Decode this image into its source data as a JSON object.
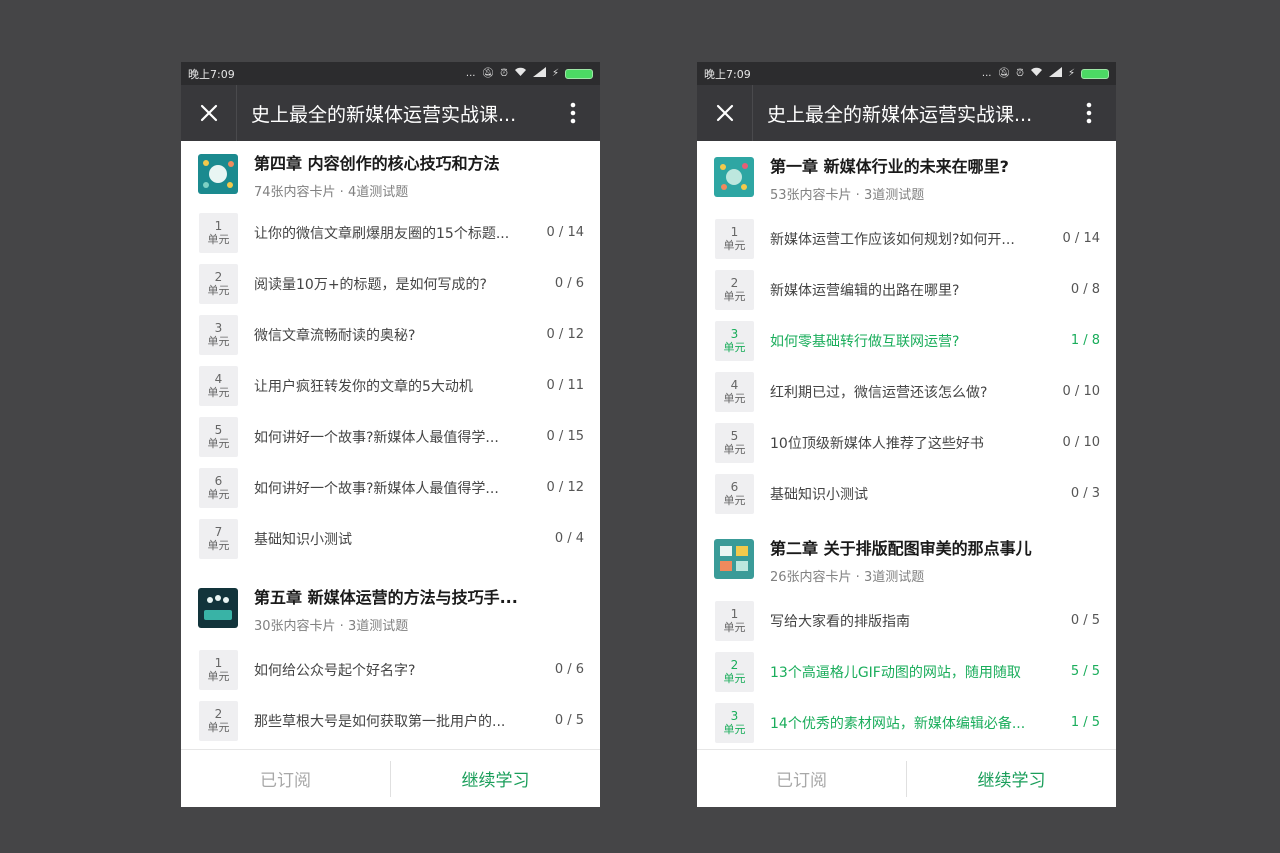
{
  "colors": {
    "accent": "#1aad5b",
    "titlebar": "#38383b",
    "statusbar": "#2c2c2e",
    "background": "#454547"
  },
  "left": {
    "status": {
      "time": "晚上7:09",
      "dots": "..."
    },
    "title": "史上最全的新媒体运营实战课...",
    "sections": [
      {
        "chapter": {
          "title": "第四章 内容创作的核心技巧和方法",
          "meta": "74张内容卡片 · 4道测试题",
          "thumb": "teal-illustration"
        },
        "units": [
          {
            "num": "1",
            "label": "单元",
            "title": "让你的微信文章刷爆朋友圈的15个标题...",
            "progress": "0 / 14"
          },
          {
            "num": "2",
            "label": "单元",
            "title": "阅读量10万+的标题，是如何写成的?",
            "progress": "0 / 6"
          },
          {
            "num": "3",
            "label": "单元",
            "title": "微信文章流畅耐读的奥秘?",
            "progress": "0 / 12"
          },
          {
            "num": "4",
            "label": "单元",
            "title": "让用户疯狂转发你的文章的5大动机",
            "progress": "0 / 11"
          },
          {
            "num": "5",
            "label": "单元",
            "title": "如何讲好一个故事?新媒体人最值得学...",
            "progress": "0 / 15"
          },
          {
            "num": "6",
            "label": "单元",
            "title": "如何讲好一个故事?新媒体人最值得学...",
            "progress": "0 / 12"
          },
          {
            "num": "7",
            "label": "单元",
            "title": "基础知识小测试",
            "progress": "0 / 4"
          }
        ]
      },
      {
        "chapter": {
          "title": "第五章 新媒体运营的方法与技巧手...",
          "meta": "30张内容卡片 · 3道测试题",
          "thumb": "dark-teal-illustration"
        },
        "units": [
          {
            "num": "1",
            "label": "单元",
            "title": "如何给公众号起个好名字?",
            "progress": "0 / 6"
          },
          {
            "num": "2",
            "label": "单元",
            "title": "那些草根大号是如何获取第一批用户的...",
            "progress": "0 / 5"
          }
        ]
      }
    ],
    "bottom": {
      "subscribed": "已订阅",
      "continue": "继续学习"
    }
  },
  "right": {
    "status": {
      "time": "晚上7:09",
      "dots": "..."
    },
    "title": "史上最全的新媒体运营实战课...",
    "sections": [
      {
        "chapter": {
          "title": "第一章 新媒体行业的未来在哪里?",
          "meta": "53张内容卡片 · 3道测试题",
          "thumb": "teal-illustration"
        },
        "units": [
          {
            "num": "1",
            "label": "单元",
            "title": "新媒体运营工作应该如何规划?如何开...",
            "progress": "0 / 14",
            "done": false
          },
          {
            "num": "2",
            "label": "单元",
            "title": "新媒体运营编辑的出路在哪里?",
            "progress": "0 / 8",
            "done": false
          },
          {
            "num": "3",
            "label": "单元",
            "title": "如何零基础转行做互联网运营?",
            "progress": "1 / 8",
            "done": true
          },
          {
            "num": "4",
            "label": "单元",
            "title": "红利期已过，微信运营还该怎么做?",
            "progress": "0 / 10",
            "done": false
          },
          {
            "num": "5",
            "label": "单元",
            "title": "10位顶级新媒体人推荐了这些好书",
            "progress": "0 / 10",
            "done": false
          },
          {
            "num": "6",
            "label": "单元",
            "title": "基础知识小测试",
            "progress": "0 / 3",
            "done": false
          }
        ]
      },
      {
        "chapter": {
          "title": "第二章 关于排版配图审美的那点事儿",
          "meta": "26张内容卡片 · 3道测试题",
          "thumb": "teal-illustration"
        },
        "units": [
          {
            "num": "1",
            "label": "单元",
            "title": "写给大家看的排版指南",
            "progress": "0 / 5",
            "done": false
          },
          {
            "num": "2",
            "label": "单元",
            "title": "13个高逼格儿GIF动图的网站，随用随取",
            "progress": "5 / 5",
            "done": true
          },
          {
            "num": "3",
            "label": "单元",
            "title": "14个优秀的素材网站，新媒体编辑必备...",
            "progress": "1 / 5",
            "done": true
          }
        ]
      }
    ],
    "bottom": {
      "subscribed": "已订阅",
      "continue": "继续学习"
    }
  }
}
